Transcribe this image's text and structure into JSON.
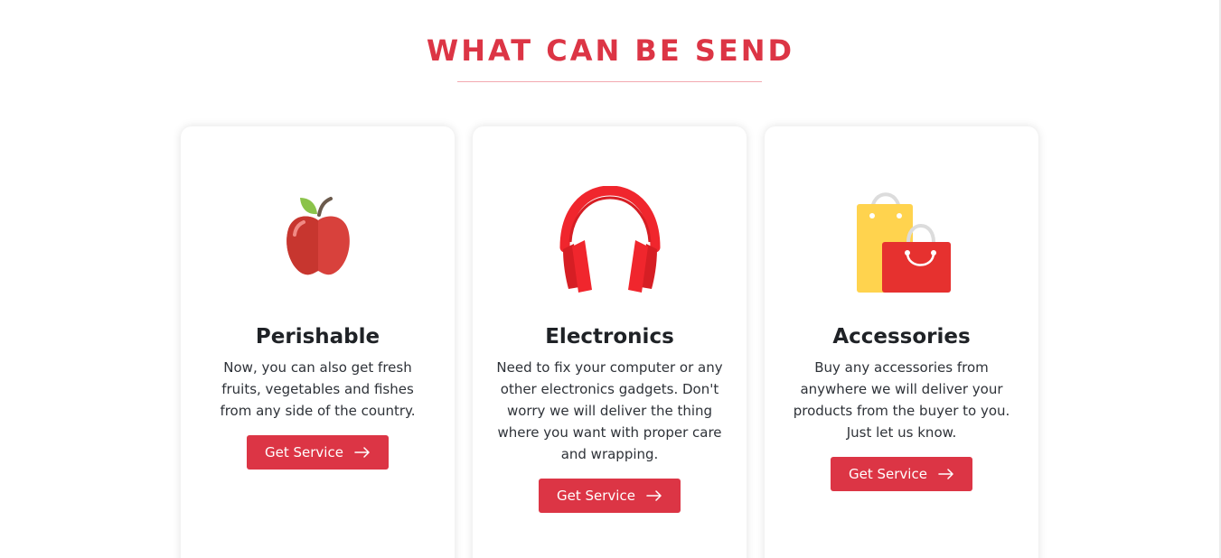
{
  "section": {
    "title": "WHAT CAN BE SEND"
  },
  "cards": [
    {
      "icon": "apple-icon",
      "title": "Perishable",
      "text": "Now, you can also get fresh fruits, vegetables and fishes from any side of the country.",
      "button_label": "Get Service"
    },
    {
      "icon": "headphones-icon",
      "title": "Electronics",
      "text": "Need to fix your computer or any other electronics gadgets. Don't worry we will deliver the thing where you want with proper care and wrapping.",
      "button_label": "Get Service"
    },
    {
      "icon": "shopping-bags-icon",
      "title": "Accessories",
      "text": "Buy any accessories from anywhere we will deliver your products from the buyer to you. Just let us know.",
      "button_label": "Get Service"
    }
  ],
  "colors": {
    "accent": "#dc3545",
    "heading": "#1f2226",
    "body_text": "#2e3238"
  }
}
